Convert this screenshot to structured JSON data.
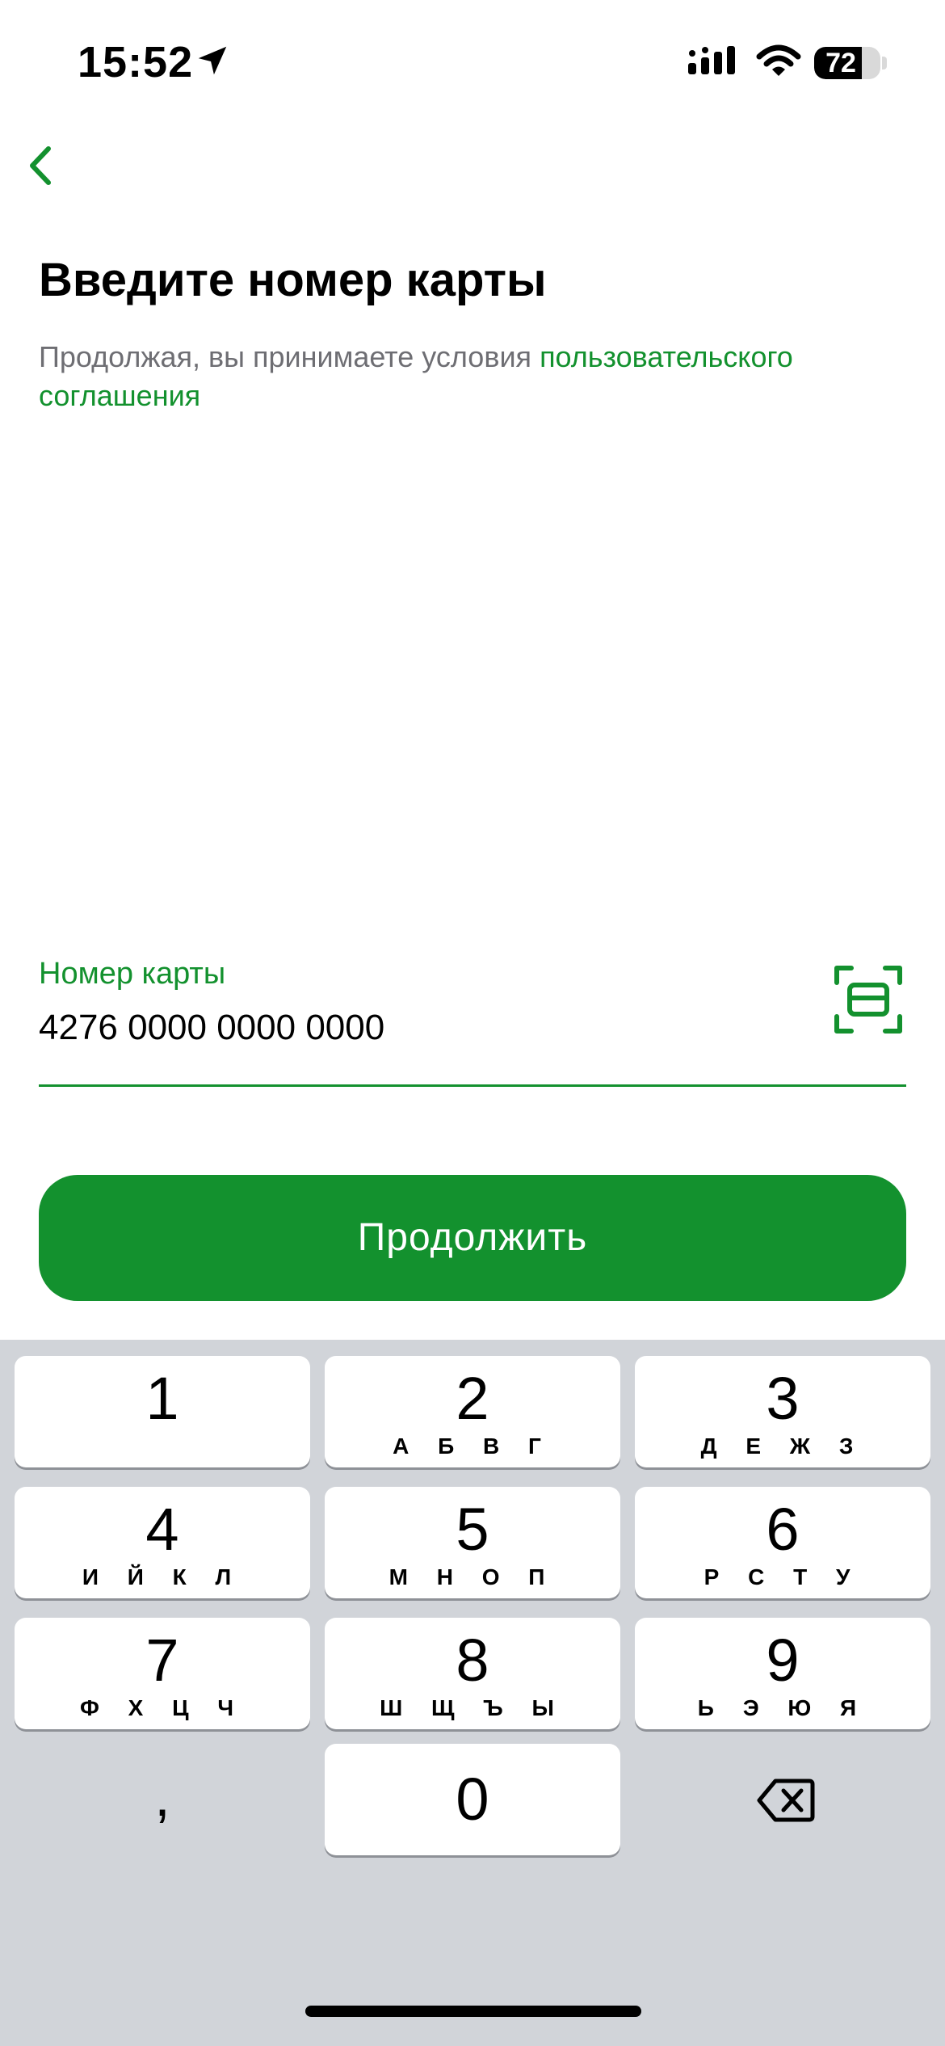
{
  "status_bar": {
    "time": "15:52",
    "battery_percent": "72",
    "battery_level": 0.72,
    "icons": [
      "location-arrow-icon",
      "cellular-signal-icon",
      "wifi-icon",
      "battery-icon"
    ]
  },
  "header": {
    "back_icon": "chevron-left-icon",
    "title": "Введите номер карты",
    "terms_prefix": "Продолжая, вы принимаете условия ",
    "terms_link": "пользовательского соглашения"
  },
  "card_field": {
    "label": "Номер карты",
    "value": "4276 0000 0000 0000",
    "scan_icon": "card-scan-icon"
  },
  "continue_button": {
    "label": "Продолжить"
  },
  "colors": {
    "accent": "#13912e",
    "secondary_text": "#6e6e73",
    "keypad_bg": "#d1d4d9",
    "key_bg": "#ffffff"
  },
  "keypad": {
    "keys": [
      {
        "digit": "1",
        "letters": ""
      },
      {
        "digit": "2",
        "letters": "А Б В Г"
      },
      {
        "digit": "3",
        "letters": "Д Е Ж З"
      },
      {
        "digit": "4",
        "letters": "И Й К Л"
      },
      {
        "digit": "5",
        "letters": "М Н О П"
      },
      {
        "digit": "6",
        "letters": "Р С Т У"
      },
      {
        "digit": "7",
        "letters": "Ф Х Ц Ч"
      },
      {
        "digit": "8",
        "letters": "Ш Щ Ъ Ы"
      },
      {
        "digit": "9",
        "letters": "Ь Э Ю Я"
      },
      {
        "digit": "0",
        "letters": ""
      }
    ],
    "comma": ",",
    "delete_icon": "backspace-icon"
  }
}
